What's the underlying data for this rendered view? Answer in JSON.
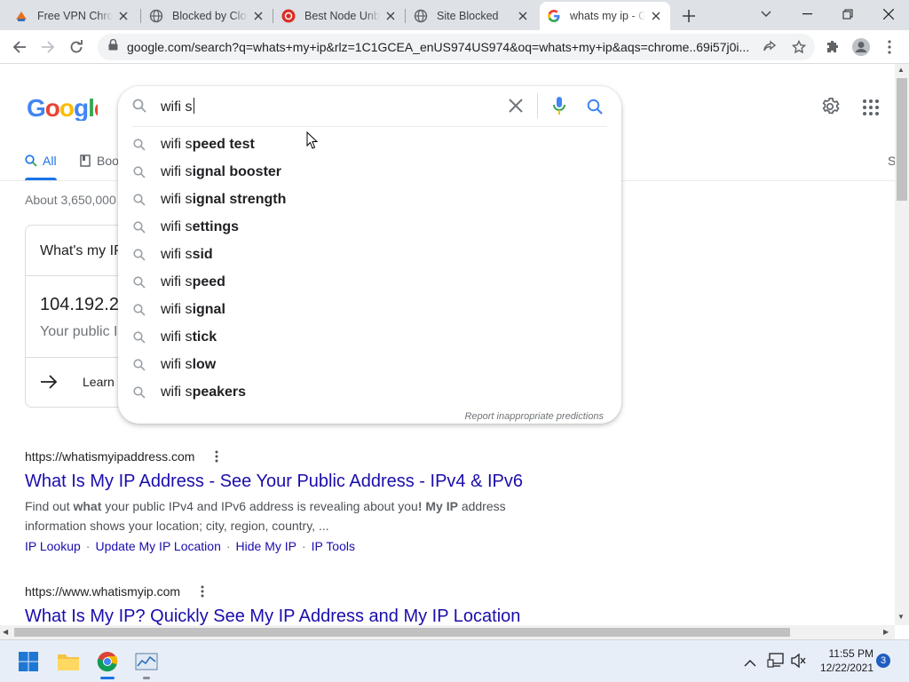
{
  "tabs": [
    {
      "title": "Free VPN Chrome",
      "favicon": "vpn-icon"
    },
    {
      "title": "Blocked by Cloud",
      "favicon": "globe-icon"
    },
    {
      "title": "Best Node Unbl",
      "favicon": "node-icon"
    },
    {
      "title": "Site Blocked",
      "favicon": "globe-icon"
    },
    {
      "title": "whats my ip - G",
      "favicon": "google-icon",
      "active": true
    }
  ],
  "address_bar": {
    "url": "google.com/search?q=whats+my+ip&rlz=1C1GCEA_enUS974US974&oq=whats+my+ip&aqs=chrome..69i57j0i..."
  },
  "google": {
    "logo": "Google",
    "search_query": "wifi s",
    "suggestions": [
      {
        "typed": "wifi s",
        "completion": "peed test"
      },
      {
        "typed": "wifi s",
        "completion": "ignal booster"
      },
      {
        "typed": "wifi s",
        "completion": "ignal strength"
      },
      {
        "typed": "wifi s",
        "completion": "ettings"
      },
      {
        "typed": "wifi s",
        "completion": "sid"
      },
      {
        "typed": "wifi s",
        "completion": "peed"
      },
      {
        "typed": "wifi s",
        "completion": "ignal"
      },
      {
        "typed": "wifi s",
        "completion": "tick"
      },
      {
        "typed": "wifi s",
        "completion": "low"
      },
      {
        "typed": "wifi s",
        "completion": "peakers"
      }
    ],
    "report_link": "Report inappropriate predictions",
    "nav_tabs": {
      "all": "All",
      "books": "Boo",
      "right_cut": "S"
    },
    "result_stats": "About 3,650,000",
    "knowledge_panel": {
      "title": "What's my IP",
      "ip": "104.192.2",
      "subtitle": "Your public I",
      "learn": "Learn"
    },
    "results": [
      {
        "url": "https://whatismyipaddress.com",
        "title": "What Is My IP Address - See Your Public Address - IPv4 & IPv6",
        "snippet_1a": "Find out ",
        "snippet_1b": "what",
        "snippet_1c": " your public IPv4 and IPv6 address is revealing about you",
        "snippet_1d": "! My IP",
        "snippet_1e": " address",
        "snippet_2": "information shows your location; city, region, country, ...",
        "sitelinks": [
          "IP Lookup",
          "Update My IP Location",
          "Hide My IP",
          "IP Tools"
        ]
      },
      {
        "url": "https://www.whatismyip.com",
        "title": "What Is My IP? Quickly See My IP Address and My IP Location"
      }
    ]
  },
  "taskbar": {
    "time": "11:55 PM",
    "date": "12/22/2021",
    "notification_count": "3"
  },
  "colors": {
    "link": "#1a0dab",
    "accent": "#1a73e8",
    "tabstrip": "#dee1e6"
  }
}
